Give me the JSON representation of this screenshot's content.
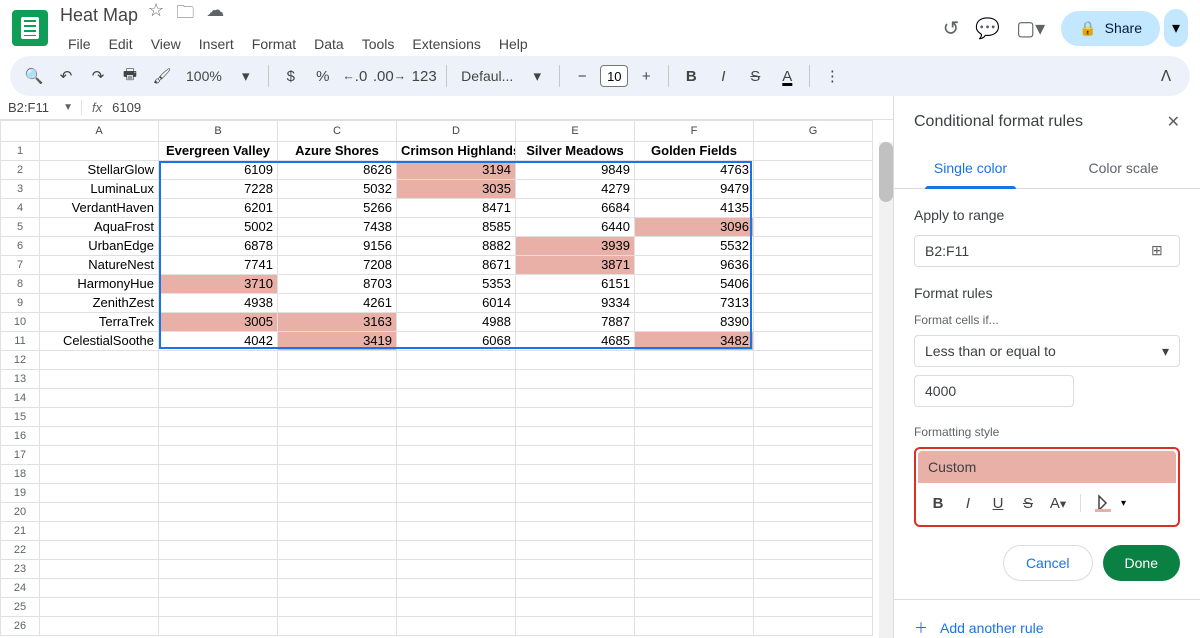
{
  "doc_title": "Heat Map",
  "menus": [
    "File",
    "Edit",
    "View",
    "Insert",
    "Format",
    "Data",
    "Tools",
    "Extensions",
    "Help"
  ],
  "share_label": "Share",
  "toolbar": {
    "zoom": "100%",
    "currency": "$",
    "percent": "%",
    "dec_dec": ".0",
    "dec_inc": ".00",
    "fmt123": "123",
    "font": "Defaul...",
    "font_size": "10"
  },
  "name_box": "B2:F11",
  "formula_value": "6109",
  "columns": [
    "A",
    "B",
    "C",
    "D",
    "E",
    "F",
    "G"
  ],
  "row_labels": [
    "",
    "StellarGlow",
    "LuminaLux",
    "VerdantHaven",
    "AquaFrost",
    "UrbanEdge",
    "NatureNest",
    "HarmonyHue",
    "ZenithZest",
    "TerraTrek",
    "CelestialSoothe"
  ],
  "col_headers": [
    "",
    "Evergreen Valley",
    "Azure Shores",
    "Crimson Highlands",
    "Silver Meadows",
    "Golden Fields"
  ],
  "grid": [
    [
      6109,
      8626,
      3194,
      9849,
      4763
    ],
    [
      7228,
      5032,
      3035,
      4279,
      9479
    ],
    [
      6201,
      5266,
      8471,
      6684,
      4135
    ],
    [
      5002,
      7438,
      8585,
      6440,
      3096
    ],
    [
      6878,
      9156,
      8882,
      3939,
      5532
    ],
    [
      7741,
      7208,
      8671,
      3871,
      9636
    ],
    [
      3710,
      8703,
      5353,
      6151,
      5406
    ],
    [
      4938,
      4261,
      6014,
      9334,
      7313
    ],
    [
      3005,
      3163,
      4988,
      7887,
      8390
    ],
    [
      4042,
      3419,
      6068,
      4685,
      3482
    ]
  ],
  "highlights": {
    "r1": [
      false,
      false,
      true,
      false,
      false
    ],
    "r2": [
      false,
      false,
      true,
      false,
      false
    ],
    "r3": [
      false,
      false,
      false,
      false,
      false
    ],
    "r4": [
      false,
      false,
      false,
      false,
      true
    ],
    "r5": [
      false,
      false,
      false,
      true,
      false
    ],
    "r6": [
      false,
      false,
      false,
      true,
      false
    ],
    "r7": [
      true,
      false,
      false,
      false,
      false
    ],
    "r8": [
      false,
      false,
      false,
      false,
      false
    ],
    "r9": [
      true,
      true,
      false,
      false,
      false
    ],
    "r10": [
      false,
      true,
      false,
      false,
      true
    ]
  },
  "sidebar": {
    "title": "Conditional format rules",
    "tab_single": "Single color",
    "tab_scale": "Color scale",
    "apply_label": "Apply to range",
    "range_value": "B2:F11",
    "rules_label": "Format rules",
    "cells_if_label": "Format cells if...",
    "condition": "Less than or equal to",
    "threshold": "4000",
    "style_label": "Formatting style",
    "style_preview": "Custom",
    "cancel": "Cancel",
    "done": "Done",
    "add_rule": "Add another rule"
  }
}
